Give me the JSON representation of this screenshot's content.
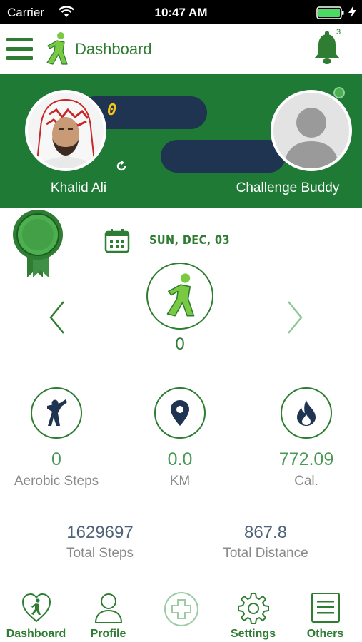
{
  "status_bar": {
    "carrier": "Carrier",
    "time": "10:47 AM"
  },
  "header": {
    "title": "Dashboard",
    "notification_count": "3"
  },
  "challenge": {
    "counter": "0",
    "user_name": "Khalid Ali",
    "buddy_name": "Challenge Buddy"
  },
  "date": "SUN, DEC, 03",
  "walk": {
    "count": "0"
  },
  "stats": [
    {
      "value": "0",
      "label": "Aerobic Steps",
      "icon": "aerobic-icon"
    },
    {
      "value": "0.0",
      "label": "KM",
      "icon": "location-pin-icon"
    },
    {
      "value": "772.09",
      "label": "Cal.",
      "icon": "flame-icon"
    }
  ],
  "totals": [
    {
      "value": "1629697",
      "label": "Total Steps"
    },
    {
      "value": "867.8",
      "label": "Total Distance"
    }
  ],
  "tabs": [
    {
      "label": "Dashboard",
      "icon": "heart-walker-icon"
    },
    {
      "label": "Profile",
      "icon": "person-icon"
    },
    {
      "label": "",
      "icon": "plus-circle-icon"
    },
    {
      "label": "Settings",
      "icon": "gear-icon"
    },
    {
      "label": "Others",
      "icon": "list-icon"
    }
  ],
  "colors": {
    "primary": "#2e7d32",
    "banner": "#1e7a35",
    "track": "#1f3450",
    "counter": "#f5c518",
    "walker": "#7ac943"
  }
}
